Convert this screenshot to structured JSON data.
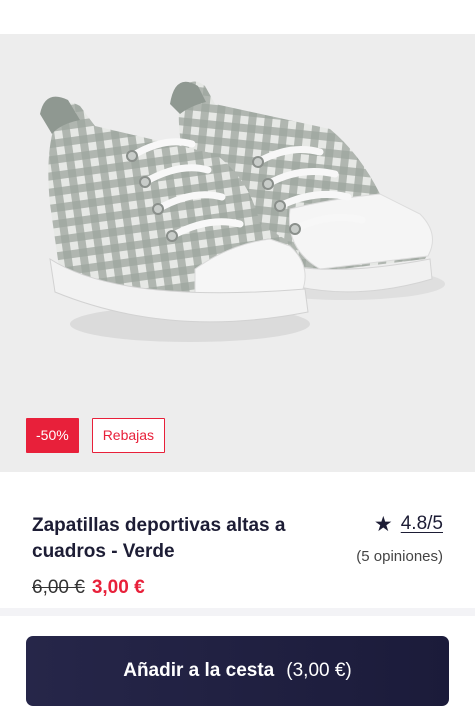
{
  "product": {
    "image_alt": "Zapatillas deportivas altas a cuadros",
    "badges": {
      "discount": "-50%",
      "sale": "Rebajas"
    },
    "title": "Zapatillas deportivas altas a cuadros - Verde",
    "rating": {
      "value": "4.8/5",
      "reviews": "(5 opiniones)"
    },
    "price": {
      "old": "6,00 €",
      "new": "3,00 €"
    }
  },
  "cta": {
    "label": "Añadir a la cesta",
    "price": "(3,00 €)"
  },
  "colors": {
    "accent_red": "#e8203a",
    "navy": "#1d1d35",
    "image_bg": "#ededed"
  },
  "icons": {
    "rating": "star-icon"
  }
}
